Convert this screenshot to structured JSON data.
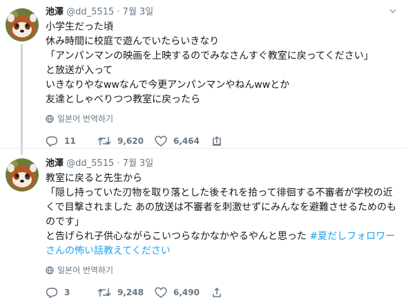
{
  "tweets": [
    {
      "name": "池澤",
      "handle": "@dd_5515",
      "sep": "·",
      "date": "7월 3일",
      "text": "小学生だった頃\n休み時間に校庭で遊んでいたらいきなり\n「アンパンマンの映画を上映するのでみなさんすぐ教室に戻ってください」\nと放送が入って\nいきなりやなwwなんで今更アンパンマンやねんwwとか\n友達としゃべりつつ教室に戻ったら",
      "hashtag": "",
      "translate_label": "일본어 번역하기",
      "replies": "11",
      "retweets": "9,620",
      "likes": "6,464"
    },
    {
      "name": "池澤",
      "handle": "@dd_5515",
      "sep": "·",
      "date": "7월 3일",
      "text": "教室に戻ると先生から\n「隠し持っていた刃物を取り落とした後それを拾って徘徊する不審者が学校の近くで目撃されました あの放送は不審者を刺激せずにみんなを避難させるためのものです」\nと告げられ子供心ながらこいつらなかなかやるやんと思った ",
      "hashtag": "#夏だしフォロワーさんの怖い話教えてください",
      "translate_label": "일본어 번역하기",
      "replies": "3",
      "retweets": "9,248",
      "likes": "6,490"
    }
  ],
  "colors": {
    "accent": "#1da1f2",
    "meta": "#657786",
    "thread_line": "#ccd6dd"
  },
  "icons": [
    "red-panda-avatar",
    "chevron-down-icon",
    "globe-icon",
    "reply-icon",
    "retweet-icon",
    "heart-icon",
    "share-icon"
  ]
}
